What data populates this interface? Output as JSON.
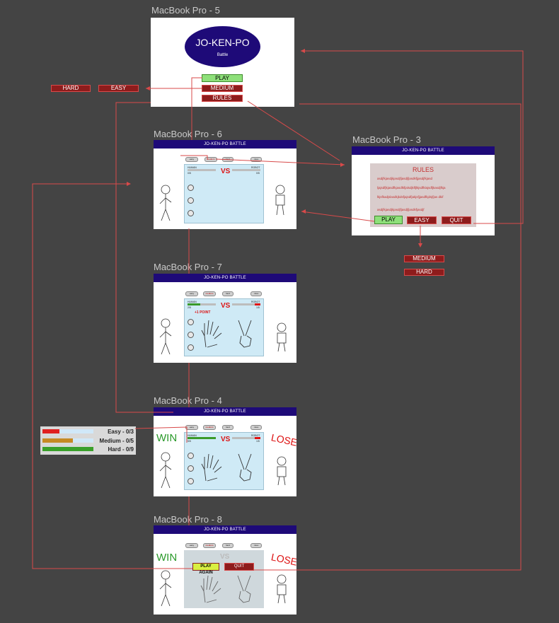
{
  "frames": {
    "f5": {
      "title": "MacBook Pro - 5",
      "logo_title": "JO-KEN-PO",
      "logo_sub": "Battle",
      "play": "PLAY",
      "medium": "MEDIUM",
      "rules": "RULES"
    },
    "f6": {
      "title": "MacBook Pro - 6",
      "bar": "JO-KEN-PO BATTLE"
    },
    "f3": {
      "title": "MacBook Pro - 3",
      "bar": "JO-KEN-PO BATTLE",
      "heading": "RULES",
      "lines": [
        "asdjfkjasdjkjasdjfjasdjfjasdkfjjasdjfkjasd",
        "ljajsdfjkjasdfkjasdlkfjalsdjklfjlkjsdfklajsdfjkasdjfkja",
        "lkjsfkadjslasdkjkdsfjajsdfjakjsfjjasdfkjdsjfjas dkif",
        "asdjfkjasdjkjasdjfjasdjfjasdkfjasdjf"
      ],
      "play": "PLAY",
      "easy": "EASY",
      "quit": "QUIT"
    },
    "f7": {
      "title": "MacBook Pro - 7",
      "bar": "JO-KEN-PO BATTLE",
      "point": "+1 POINT"
    },
    "f4": {
      "title": "MacBook Pro - 4",
      "bar": "JO-KEN-PO BATTLE",
      "win": "WIN",
      "lose": "LOSE"
    },
    "f8": {
      "title": "MacBook Pro - 8",
      "bar": "JO-KEN-PO BATTLE",
      "win": "WIN",
      "lose": "LOSE",
      "play_again": "PLAY AGAIN",
      "quit": "QUIT"
    }
  },
  "game": {
    "easy": "easy",
    "medium": "medium",
    "hard": "hard",
    "rules": "rules",
    "human": "HUMAN",
    "robot": "ROBOT",
    "vs": "VS",
    "h6": "0/5",
    "r6": "0/5",
    "h7": "2/5",
    "r7": "1/5",
    "h4": "5/5",
    "r4": "1/5"
  },
  "side": {
    "hard": "HARD",
    "easy": "EASY",
    "medium": "MEDIUM"
  },
  "legend": {
    "easy": "Easy - 0/3",
    "medium": "Medium - 0/5",
    "hard": "Hard - 0/9"
  },
  "colors": {
    "accent": "#1e0a78",
    "button_red": "#8e1c1c",
    "button_green": "#8ee07a",
    "arrow": "#d84a4a"
  }
}
